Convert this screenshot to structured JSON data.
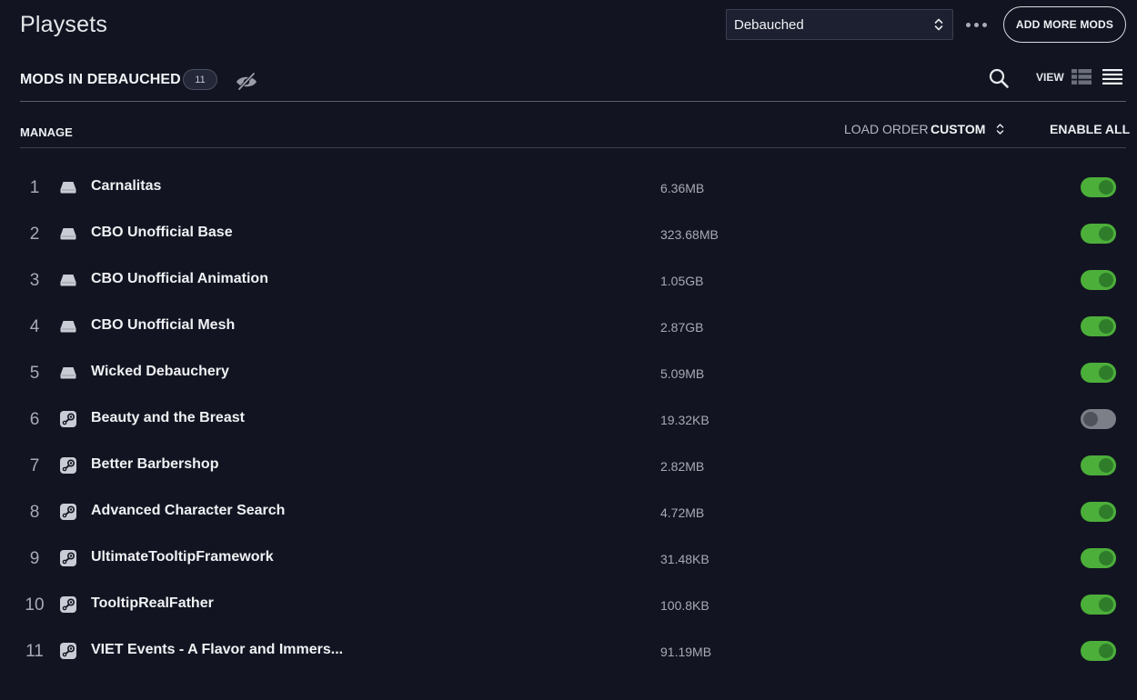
{
  "header": {
    "title": "Playsets",
    "playset_selected": "Debauched",
    "add_more_mods_label": "ADD MORE MODS"
  },
  "mods_header": {
    "title": "MODS IN DEBAUCHED",
    "count": "11",
    "view_label": "VIEW"
  },
  "toolbar": {
    "manage_label": "MANAGE",
    "load_order_label": "LOAD ORDER",
    "load_order_value": "CUSTOM",
    "enable_all_label": "ENABLE ALL"
  },
  "colors": {
    "background": "#121521",
    "toggle_on": "#4caf3a",
    "toggle_off": "#7c7f88"
  },
  "mods": [
    {
      "index": "1",
      "name": "Carnalitas",
      "size": "6.36MB",
      "source": "local-drive-icon",
      "enabled": true
    },
    {
      "index": "2",
      "name": "CBO Unofficial Base",
      "size": "323.68MB",
      "source": "local-drive-icon",
      "enabled": true
    },
    {
      "index": "3",
      "name": "CBO Unofficial Animation",
      "size": "1.05GB",
      "source": "local-drive-icon",
      "enabled": true
    },
    {
      "index": "4",
      "name": "CBO Unofficial Mesh",
      "size": "2.87GB",
      "source": "local-drive-icon",
      "enabled": true
    },
    {
      "index": "5",
      "name": "Wicked Debauchery",
      "size": "5.09MB",
      "source": "local-drive-icon",
      "enabled": true
    },
    {
      "index": "6",
      "name": "Beauty and the Breast",
      "size": "19.32KB",
      "source": "steam-icon",
      "enabled": false
    },
    {
      "index": "7",
      "name": "Better Barbershop",
      "size": "2.82MB",
      "source": "steam-icon",
      "enabled": true
    },
    {
      "index": "8",
      "name": "Advanced Character Search",
      "size": "4.72MB",
      "source": "steam-icon",
      "enabled": true
    },
    {
      "index": "9",
      "name": "UltimateTooltipFramework",
      "size": "31.48KB",
      "source": "steam-icon",
      "enabled": true
    },
    {
      "index": "10",
      "name": "TooltipRealFather",
      "size": "100.8KB",
      "source": "steam-icon",
      "enabled": true
    },
    {
      "index": "11",
      "name": "VIET Events - A Flavor and Immers...",
      "size": "91.19MB",
      "source": "steam-icon",
      "enabled": true
    }
  ]
}
